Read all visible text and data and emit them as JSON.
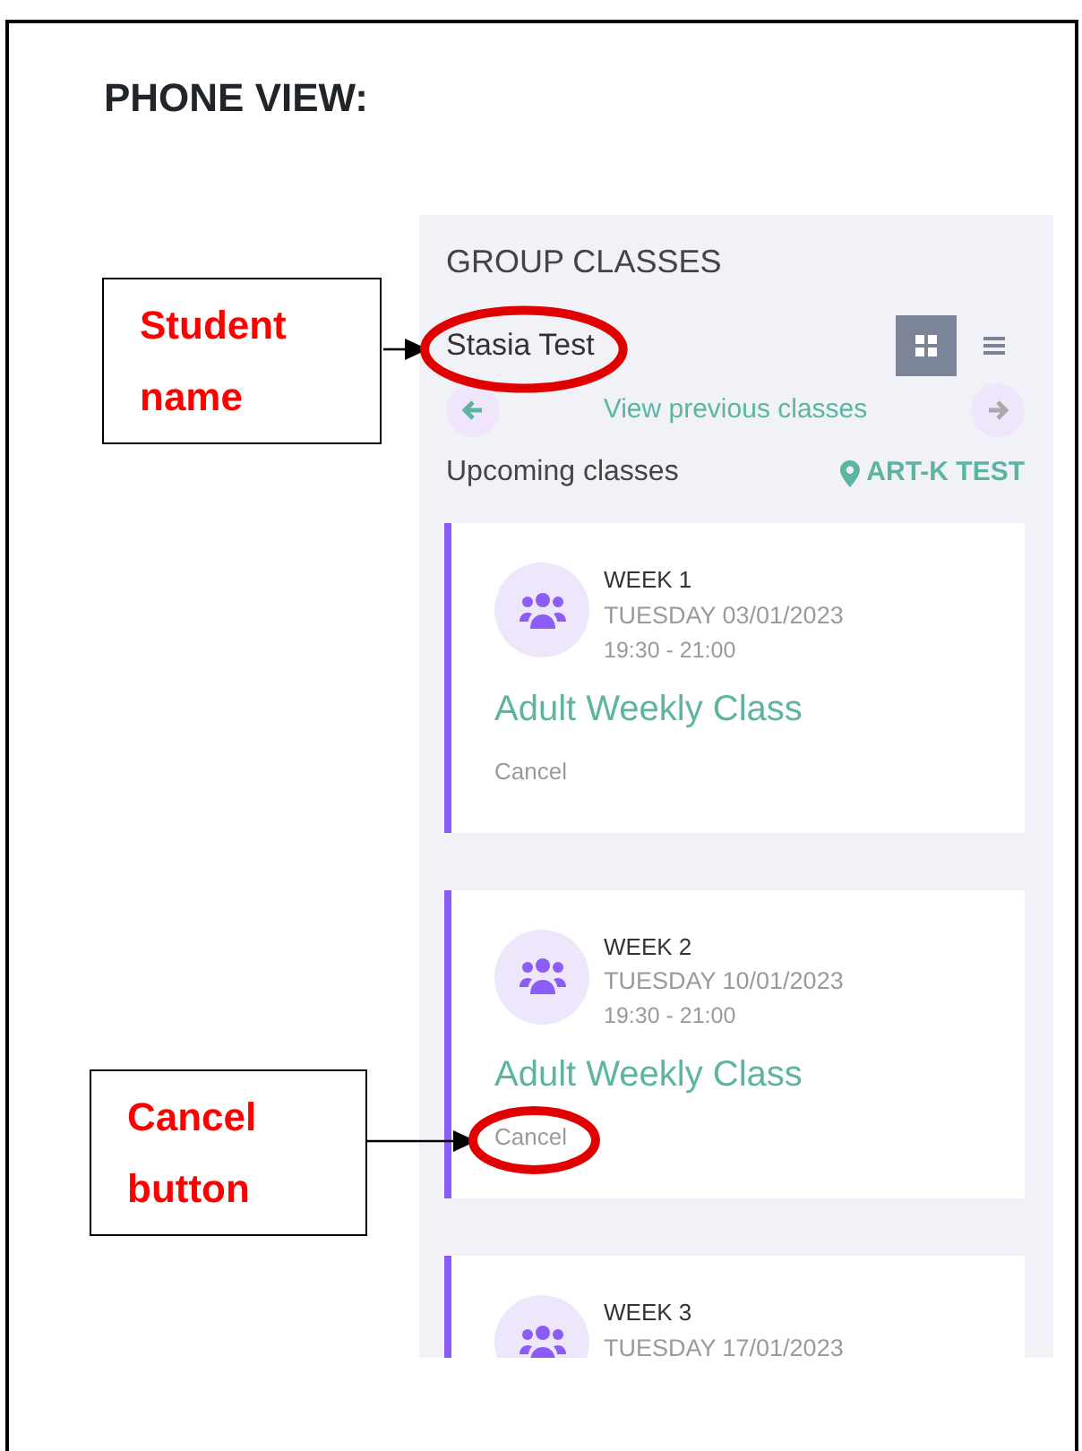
{
  "heading": "PHONE VIEW:",
  "app": {
    "title": "GROUP CLASSES",
    "student_name": "Stasia Test",
    "view_toggle": [
      {
        "kind": "grid",
        "selected": true
      },
      {
        "kind": "list",
        "selected": false
      }
    ],
    "previous_link": "View previous classes",
    "section_label": "Upcoming classes",
    "location": "ART-K TEST",
    "classes": [
      {
        "week": "WEEK 1",
        "date": "TUESDAY 03/01/2023",
        "time": "19:30 - 21:00",
        "name": "Adult Weekly Class",
        "action": "Cancel"
      },
      {
        "week": "WEEK 2",
        "date": "TUESDAY 10/01/2023",
        "time": "19:30 - 21:00",
        "name": "Adult Weekly Class",
        "action": "Cancel"
      },
      {
        "week": "WEEK 3",
        "date": "TUESDAY 17/01/2023"
      }
    ]
  },
  "callouts": [
    {
      "text": "Student name"
    },
    {
      "text": "Cancel button"
    }
  ]
}
